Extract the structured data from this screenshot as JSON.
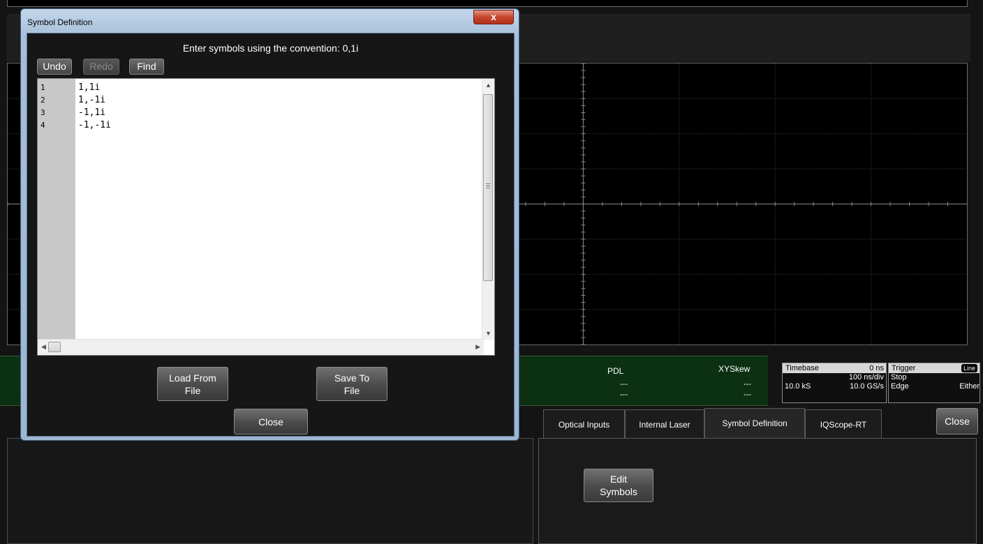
{
  "dialog": {
    "title": "Symbol Definition",
    "close_glyph": "x",
    "instruction": "Enter symbols using the convention: 0,1i",
    "toolbar": {
      "undo": "Undo",
      "redo": "Redo",
      "find": "Find"
    },
    "editor": {
      "lines": [
        {
          "num": "1",
          "text": "1,1i"
        },
        {
          "num": "2",
          "text": "1,-1i"
        },
        {
          "num": "3",
          "text": "-1,1i"
        },
        {
          "num": "4",
          "text": "-1,-1i"
        }
      ]
    },
    "load_button": "Load From\nFile",
    "save_button": "Save To\nFile",
    "close_button": "Close"
  },
  "measurements": {
    "pdl": {
      "label": "PDL",
      "value1": "---",
      "value2": "---"
    },
    "xyskew": {
      "label": "XYSkew",
      "value1": "---",
      "value2": "---"
    }
  },
  "timebase": {
    "title": "Timebase",
    "offset": "0 ns",
    "per_div": "100 ns/div",
    "samples": "10.0 kS",
    "rate": "10.0 GS/s"
  },
  "trigger": {
    "title": "Trigger",
    "badge": "Line",
    "mode": "Stop",
    "type": "Edge",
    "slope": "Either"
  },
  "tabs": [
    "Optical Inputs",
    "Internal Laser",
    "Symbol Definition",
    "IQScope-RT"
  ],
  "active_tab": "Symbol Definition",
  "panel_close": "Close",
  "edit_symbols_button": "Edit\nSymbols",
  "colors": {
    "info_strip": "#0c3112",
    "dialog_frame": "#a7bfd9",
    "close_red": "#c6452d"
  }
}
